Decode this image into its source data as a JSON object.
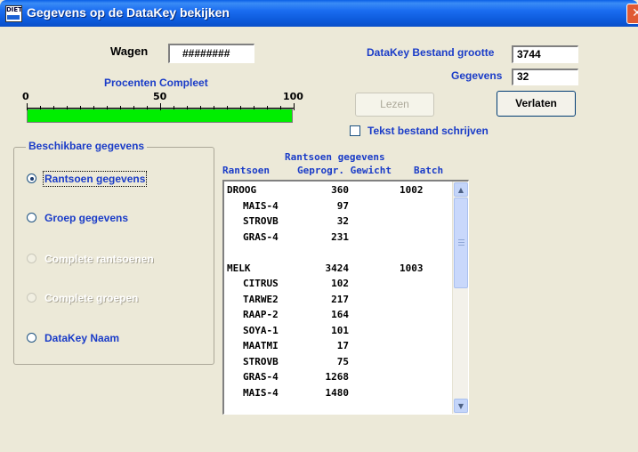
{
  "window": {
    "title": "Gegevens op de DataKey bekijken",
    "close_glyph": "✕",
    "app_icon_text": "DIET"
  },
  "wagen": {
    "label": "Wagen",
    "value": "########"
  },
  "datakey": {
    "size_label": "DataKey Bestand grootte",
    "size_value": "3744",
    "count_label": "Gegevens",
    "count_value": "32"
  },
  "progress": {
    "label": "Procenten Compleet",
    "scale": [
      "0",
      "50",
      "100"
    ],
    "percent": 100,
    "fill_color": "#00ee00"
  },
  "buttons": {
    "read_label": "Lezen",
    "read_enabled": false,
    "exit_label": "Verlaten"
  },
  "checkbox": {
    "label": "Tekst bestand schrijven",
    "checked": false
  },
  "available": {
    "title": "Beschikbare gegevens",
    "options": [
      {
        "label": "Rantsoen gegevens",
        "selected": true,
        "enabled": true
      },
      {
        "label": "Groep gegevens",
        "selected": false,
        "enabled": true
      },
      {
        "label": "Complete rantsoenen",
        "selected": false,
        "enabled": false
      },
      {
        "label": "Complete groepen",
        "selected": false,
        "enabled": false
      },
      {
        "label": "DataKey Naam",
        "selected": false,
        "enabled": true
      }
    ]
  },
  "ration_list": {
    "title": "Rantsoen gegevens",
    "columns": [
      "Rantsoen",
      "Geprogr. Gewicht",
      "Batch"
    ],
    "rows": [
      {
        "name": "DROOG",
        "weight": "360",
        "batch": "1002",
        "indent": false
      },
      {
        "name": "MAIS-4",
        "weight": "97",
        "batch": "",
        "indent": true
      },
      {
        "name": "STROVB",
        "weight": "32",
        "batch": "",
        "indent": true
      },
      {
        "name": "GRAS-4",
        "weight": "231",
        "batch": "",
        "indent": true
      },
      {
        "name": "",
        "weight": "",
        "batch": "",
        "indent": false
      },
      {
        "name": "MELK",
        "weight": "3424",
        "batch": "1003",
        "indent": false
      },
      {
        "name": "CITRUS",
        "weight": "102",
        "batch": "",
        "indent": true
      },
      {
        "name": "TARWE2",
        "weight": "217",
        "batch": "",
        "indent": true
      },
      {
        "name": "RAAP-2",
        "weight": "164",
        "batch": "",
        "indent": true
      },
      {
        "name": "SOYA-1",
        "weight": "101",
        "batch": "",
        "indent": true
      },
      {
        "name": "MAATMI",
        "weight": "17",
        "batch": "",
        "indent": true
      },
      {
        "name": "STROVB",
        "weight": "75",
        "batch": "",
        "indent": true
      },
      {
        "name": "GRAS-4",
        "weight": "1268",
        "batch": "",
        "indent": true
      },
      {
        "name": "MAIS-4",
        "weight": "1480",
        "batch": "",
        "indent": true
      }
    ],
    "scroll_up_glyph": "▲",
    "scroll_down_glyph": "▼"
  }
}
